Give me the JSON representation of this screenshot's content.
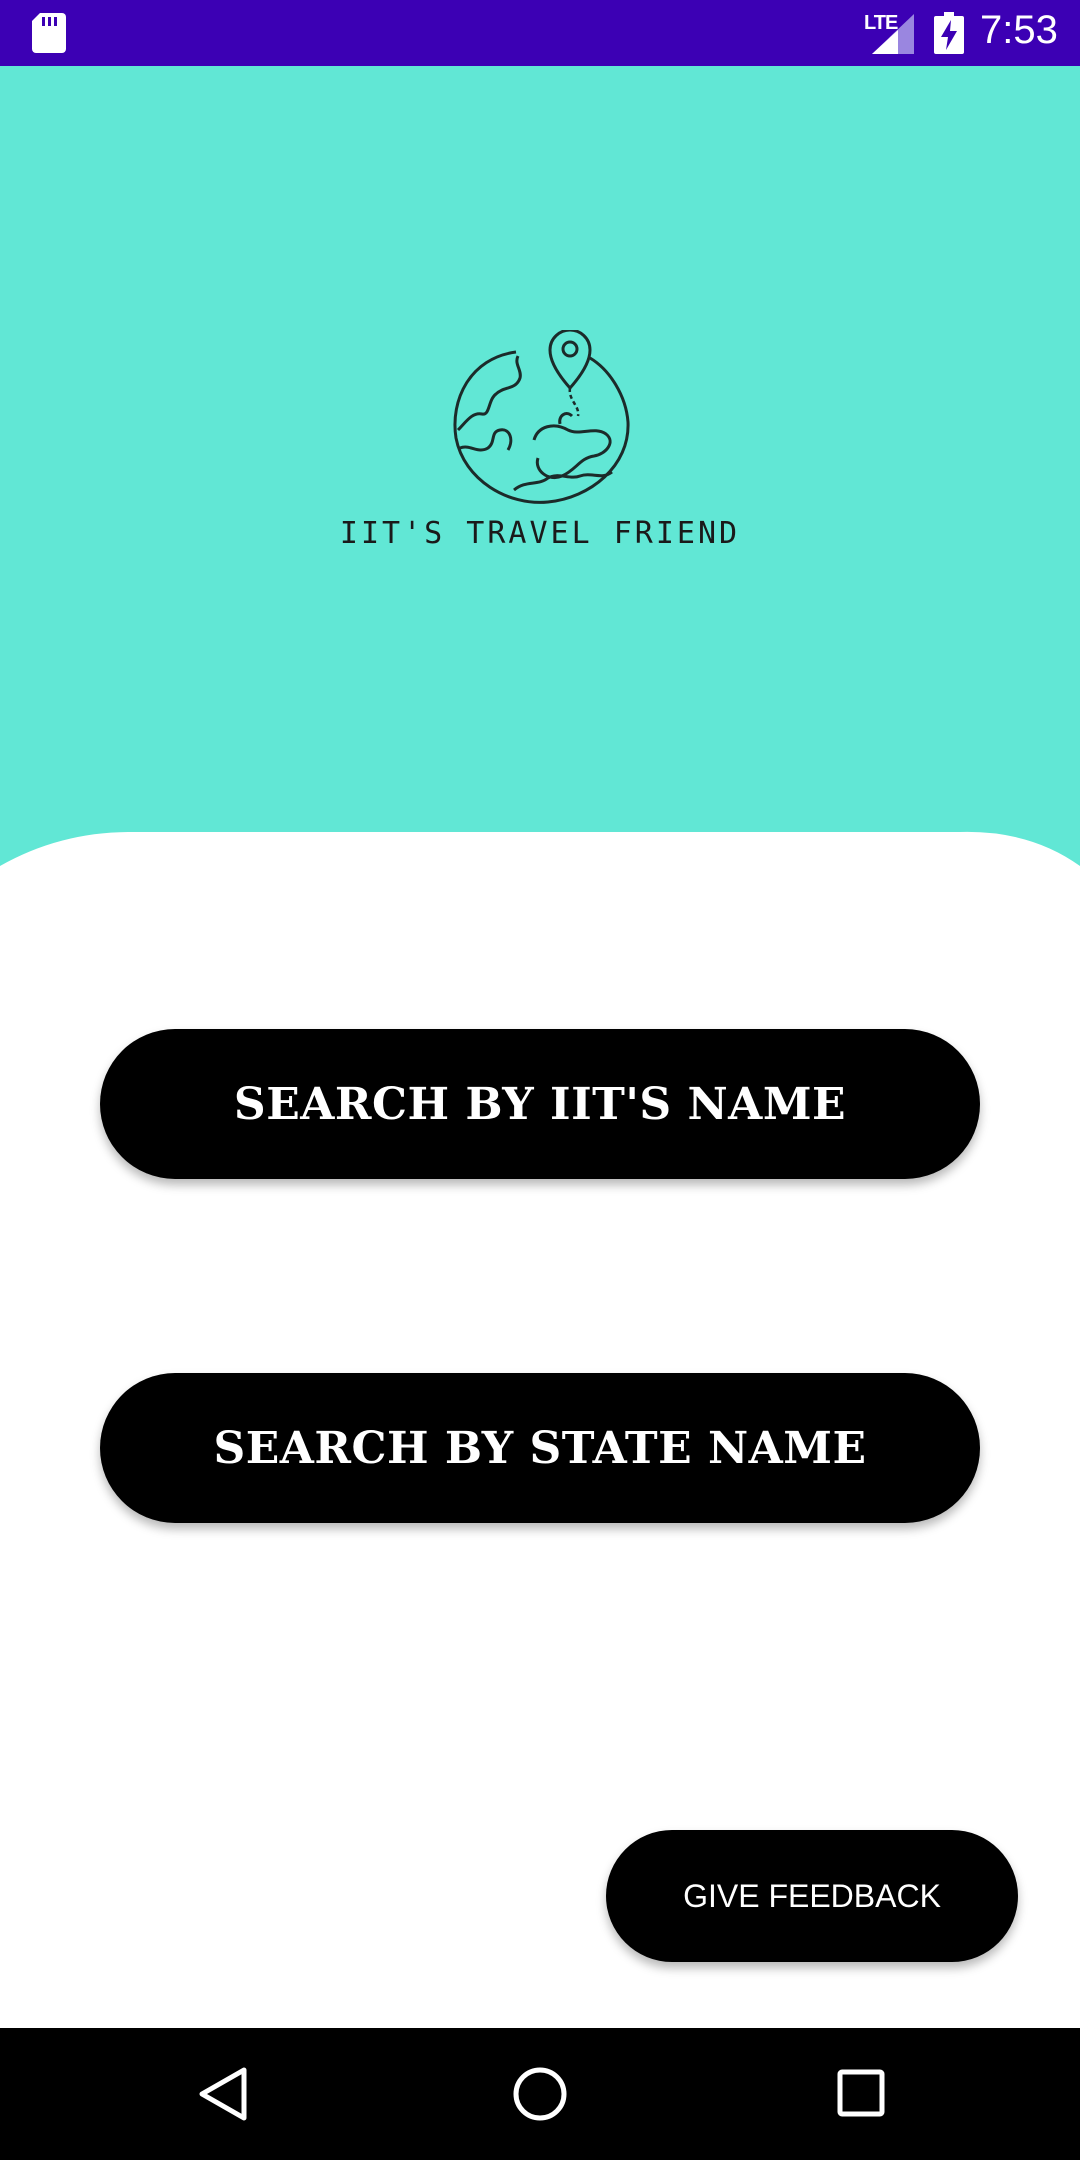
{
  "status_bar": {
    "time": "7:53",
    "network_label": "LTE",
    "icons": [
      "sd-card-icon",
      "signal-icon",
      "battery-charging-icon"
    ]
  },
  "header": {
    "app_name": "IIT'S TRAVEL FRIEND",
    "logo_icon": "globe-location-pin-icon"
  },
  "main": {
    "search_iit_label": "SEARCH BY IIT'S NAME",
    "search_state_label": "SEARCH BY STATE NAME",
    "feedback_label": "GIVE FEEDBACK"
  },
  "nav_bar": {
    "icons": [
      "back-icon",
      "home-icon",
      "recents-icon"
    ]
  },
  "colors": {
    "status_bar": "#3c00b4",
    "header": "#61e7d5",
    "button": "#000000",
    "button_text": "#ffffff",
    "background": "#ffffff"
  }
}
